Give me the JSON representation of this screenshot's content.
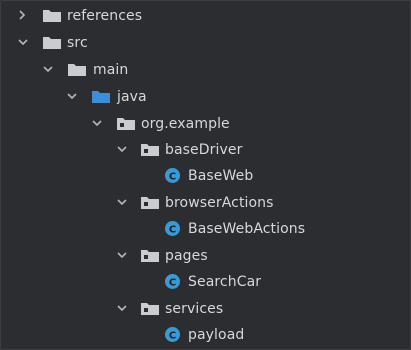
{
  "tree": {
    "items": [
      {
        "label": "references",
        "kind": "folder",
        "expanded": false
      },
      {
        "label": "src",
        "kind": "folder",
        "expanded": true
      },
      {
        "label": "main",
        "kind": "folder",
        "expanded": true
      },
      {
        "label": "java",
        "kind": "source-folder",
        "expanded": true
      },
      {
        "label": "org.example",
        "kind": "package",
        "expanded": true
      },
      {
        "label": "baseDriver",
        "kind": "package",
        "expanded": true
      },
      {
        "label": "BaseWeb",
        "kind": "class"
      },
      {
        "label": "browserActions",
        "kind": "package",
        "expanded": true
      },
      {
        "label": "BaseWebActions",
        "kind": "class"
      },
      {
        "label": "pages",
        "kind": "package",
        "expanded": true
      },
      {
        "label": "SearchCar",
        "kind": "class"
      },
      {
        "label": "services",
        "kind": "package",
        "expanded": true
      },
      {
        "label": "payload",
        "kind": "class"
      }
    ]
  },
  "colors": {
    "background": "#2b2d30",
    "folder": "#c9ccd1",
    "source_folder": "#3d8ed9",
    "class_icon": "#3a9ad6",
    "chevron": "#b4b7bc"
  }
}
